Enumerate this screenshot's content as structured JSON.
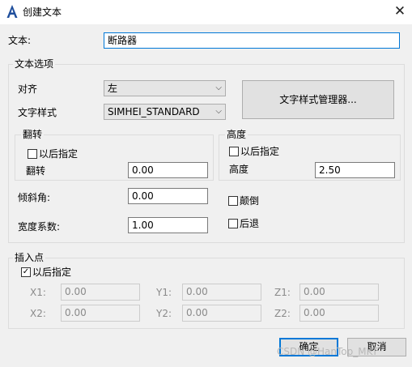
{
  "window": {
    "title": "创建文本",
    "close_glyph": "✕",
    "app_icon": "a-letter-icon"
  },
  "text_field": {
    "label": "文本:",
    "value": "断路器"
  },
  "options": {
    "title": "文本选项",
    "align": {
      "label": "对齐",
      "value": "左"
    },
    "style": {
      "label": "文字样式",
      "value": "SIMHEI_STANDARD"
    },
    "style_manager_label": "文字样式管理器...",
    "flip": {
      "title": "翻转",
      "later_label": "以后指定",
      "field_label": "翻转",
      "value": "0.00"
    },
    "height": {
      "title": "高度",
      "later_label": "以后指定",
      "field_label": "高度",
      "value": "2.50"
    },
    "oblique": {
      "label": "倾斜角:",
      "value": "0.00"
    },
    "width": {
      "label": "宽度系数:",
      "value": "1.00"
    },
    "upside_down_label": "颠倒",
    "backwards_label": "后退"
  },
  "insert_point": {
    "title": "插入点",
    "later_label": "以后指定",
    "later_checked": true,
    "check_glyph": "✓",
    "x1": {
      "label": "X1:",
      "value": "0.00"
    },
    "y1": {
      "label": "Y1:",
      "value": "0.00"
    },
    "z1": {
      "label": "Z1:",
      "value": "0.00"
    },
    "x2": {
      "label": "X2:",
      "value": "0.00"
    },
    "y2": {
      "label": "Y2:",
      "value": "0.00"
    },
    "z2": {
      "label": "Z2:",
      "value": "0.00"
    }
  },
  "buttons": {
    "ok": "确定",
    "cancel": "取消"
  },
  "watermark": "CSDN @HanTop_MKT",
  "colors": {
    "accent": "#0078d7",
    "icon": "#1f4e9c"
  }
}
